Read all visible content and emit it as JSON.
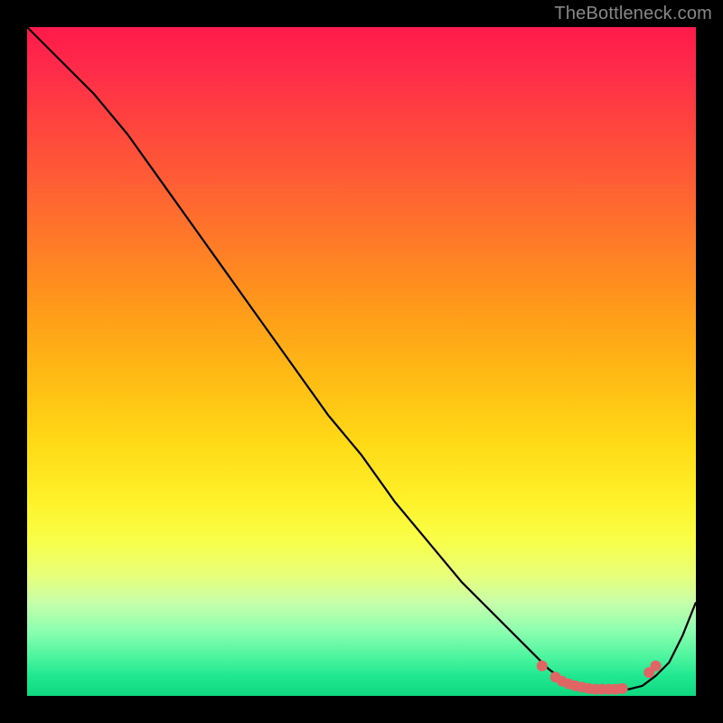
{
  "watermark": "TheBottleneck.com",
  "chart_data": {
    "type": "line",
    "x": [
      0.0,
      0.05,
      0.1,
      0.15,
      0.2,
      0.25,
      0.3,
      0.35,
      0.4,
      0.45,
      0.5,
      0.55,
      0.6,
      0.65,
      0.7,
      0.75,
      0.78,
      0.8,
      0.82,
      0.84,
      0.86,
      0.88,
      0.9,
      0.92,
      0.94,
      0.96,
      0.98,
      1.0
    ],
    "values": [
      100,
      95,
      90,
      84,
      77,
      70,
      63,
      56,
      49,
      42,
      36,
      29,
      23,
      17,
      12,
      7,
      4,
      2.5,
      1.5,
      1,
      1,
      1,
      1,
      1.5,
      3,
      5,
      9,
      14
    ],
    "valley_dots_x": [
      0.77,
      0.79,
      0.8,
      0.81,
      0.82,
      0.83,
      0.84,
      0.85,
      0.86,
      0.87,
      0.88,
      0.89,
      0.93,
      0.94
    ],
    "valley_dots_y": [
      4.5,
      2.8,
      2.2,
      1.8,
      1.5,
      1.3,
      1.1,
      1.0,
      1.0,
      1.0,
      1.0,
      1.1,
      3.5,
      4.5
    ],
    "title": "",
    "xlabel": "",
    "ylabel": "",
    "xlim": [
      0,
      1
    ],
    "ylim": [
      0,
      100
    ],
    "dot_color": "#e06666",
    "line_color": "#000000"
  }
}
